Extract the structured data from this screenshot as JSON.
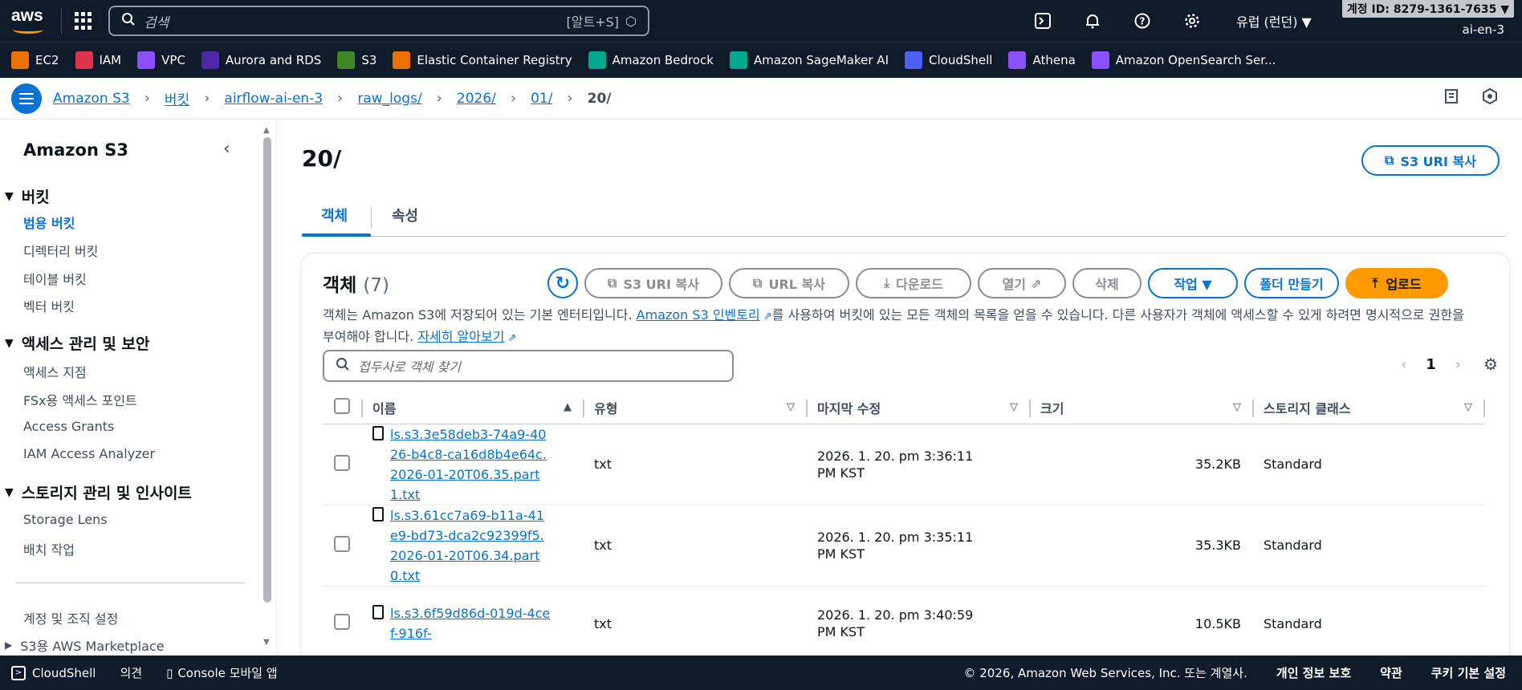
{
  "topnav": {
    "logo": "aws",
    "search_placeholder": "검색",
    "search_shortcut": "[알트+S]",
    "region": "유럽 (런던) ▼",
    "account_id": "계정 ID: 8279-1361-7635 ▼",
    "role": "ai-en-3"
  },
  "services": [
    {
      "label": "EC2",
      "color": "#ed7100"
    },
    {
      "label": "IAM",
      "color": "#dd344c"
    },
    {
      "label": "VPC",
      "color": "#8c4fff"
    },
    {
      "label": "Aurora and RDS",
      "color": "#4d27a8"
    },
    {
      "label": "S3",
      "color": "#3f8624"
    },
    {
      "label": "Elastic Container Registry",
      "color": "#ed7100"
    },
    {
      "label": "Amazon Bedrock",
      "color": "#01a88d"
    },
    {
      "label": "Amazon SageMaker AI",
      "color": "#01a88d"
    },
    {
      "label": "CloudShell",
      "color": "#4d5ff5"
    },
    {
      "label": "Athena",
      "color": "#8c4fff"
    },
    {
      "label": "Amazon OpenSearch Ser...",
      "color": "#8c4fff"
    }
  ],
  "breadcrumb": [
    "Amazon S3",
    "버킷",
    "airflow-ai-en-3",
    "raw_logs/",
    "2026/",
    "01/"
  ],
  "breadcrumb_current": "20/",
  "sidebar": {
    "title": "Amazon S3",
    "sections": {
      "buckets": "버킷",
      "access": "액세스 관리 및 보안",
      "storage": "스토리지 관리 및 인사이트"
    },
    "bucket_items": [
      "범용 버킷",
      "디렉터리 버킷",
      "테이블 버킷",
      "벡터 버킷"
    ],
    "access_items": [
      "액세스 지점",
      "FSx용 액세스 포인트",
      "Access Grants",
      "IAM Access Analyzer"
    ],
    "storage_items": [
      "Storage Lens",
      "배치 작업"
    ],
    "account_settings": "계정 및 조직 설정",
    "marketplace": "S3용 AWS Marketplace"
  },
  "main": {
    "title": "20/",
    "copy_uri_top": "S3 URI 복사",
    "tabs": [
      "객체",
      "속성"
    ],
    "panel_title": "객체",
    "object_count": "(7)",
    "buttons": {
      "copy_uri": "S3 URI 복사",
      "copy_url": "URL 복사",
      "download": "다운로드",
      "open": "열기",
      "delete": "삭제",
      "actions": "작업 ▼",
      "create_folder": "폴더 만들기",
      "upload": "업로드"
    },
    "desc_1": "객체는 Amazon S3에 저장되어 있는 기본 엔터티입니다. ",
    "desc_link_1": "Amazon S3 인벤토리",
    "desc_2": "를 사용하여 버킷에 있는 모든 객체의 목록을 얻을 수 있습니다. 다른 사용자가 객체에 액세스할 수 있게 하려면 명시적으로 권한을 부여해야 합니다. ",
    "desc_link_2": "자세히 알아보기",
    "filter_placeholder": "접두사로 객체 찾기",
    "page": "1"
  },
  "table": {
    "headers": [
      "이름",
      "유형",
      "마지막 수정",
      "크기",
      "스토리지 클래스"
    ],
    "rows": [
      {
        "name": "ls.s3.3e58deb3-74a9-4026-b4c8-ca16d8b4e64c.2026-01-20T06.35.part1.txt",
        "type": "txt",
        "modified": "2026. 1. 20. pm 3:36:11 PM KST",
        "size": "35.2KB",
        "class": "Standard"
      },
      {
        "name": "ls.s3.61cc7a69-b11a-41e9-bd73-dca2c92399f5.2026-01-20T06.34.part0.txt",
        "type": "txt",
        "modified": "2026. 1. 20. pm 3:35:11 PM KST",
        "size": "35.3KB",
        "class": "Standard"
      },
      {
        "name": "ls.s3.6f59d86d-019d-4cef-916f-",
        "type": "txt",
        "modified": "2026. 1. 20. pm 3:40:59 PM KST",
        "size": "10.5KB",
        "class": "Standard"
      }
    ]
  },
  "footer": {
    "cloudshell": "CloudShell",
    "feedback": "의견",
    "console_mobile": "Console 모바일 앱",
    "copyright": "© 2026, Amazon Web Services, Inc. 또는 계열사.",
    "privacy": "개인 정보 보호",
    "terms": "약관",
    "cookies": "쿠키 기본 설정"
  }
}
